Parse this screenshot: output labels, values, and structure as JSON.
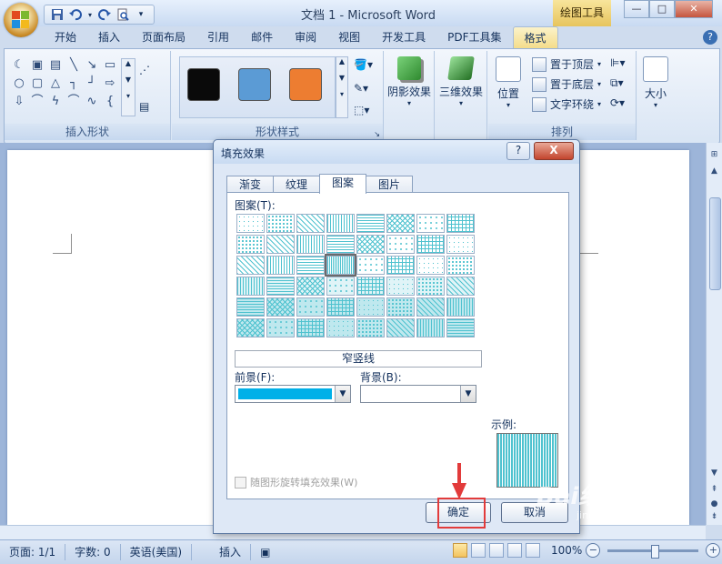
{
  "window": {
    "title": "文档 1 - Microsoft Word",
    "context_tab_title": "绘图工具",
    "buttons": {
      "minimize": "—",
      "maximize": "□",
      "close": "✕"
    }
  },
  "quick_access": {
    "items": [
      "save-icon",
      "undo-icon",
      "redo-icon",
      "print-preview-icon",
      "customize-icon"
    ]
  },
  "ribbon": {
    "tabs": [
      "开始",
      "插入",
      "页面布局",
      "引用",
      "邮件",
      "审阅",
      "视图",
      "开发工具",
      "PDF工具集",
      "格式"
    ],
    "active_tab": "格式",
    "help": "?",
    "groups": {
      "insert_shapes": {
        "label": "插入形状"
      },
      "shape_styles": {
        "label": "形状样式",
        "swatch_colors": [
          "#0a0a0a",
          "#5b9bd5",
          "#ed7d31"
        ]
      },
      "shadow_effects": {
        "label": "阴影效果"
      },
      "three_d": {
        "label": "三维效果"
      },
      "arrange": {
        "label": "排列",
        "position": "位置",
        "bring_front": "置于顶层",
        "send_back": "置于底层",
        "wrap_text": "文字环绕"
      },
      "size": {
        "label": "大小"
      }
    }
  },
  "dialog": {
    "title": "填充效果",
    "help_label": "?",
    "close_label": "X",
    "tabs": [
      "渐变",
      "纹理",
      "图案",
      "图片"
    ],
    "active_tab": "图案",
    "pattern_label": "图案(T):",
    "selected_pattern_name": "窄竖线",
    "foreground_label": "前景(F):",
    "foreground_color": "#00b0e8",
    "background_label": "背景(B):",
    "background_color": "#ffffff",
    "pattern_color": "#4fc2cf",
    "sample_label": "示例:",
    "rotate_label": "随图形旋转填充效果(W)",
    "rotate_checked": false,
    "ok_label": "确定",
    "cancel_label": "取消"
  },
  "status_bar": {
    "page": "页面: 1/1",
    "words": "字数: 0",
    "language": "英语(美国)",
    "mode": "插入",
    "zoom": "100%"
  },
  "watermark": {
    "text": "Bai经验",
    "sub": "jingyan.baidu.com"
  }
}
